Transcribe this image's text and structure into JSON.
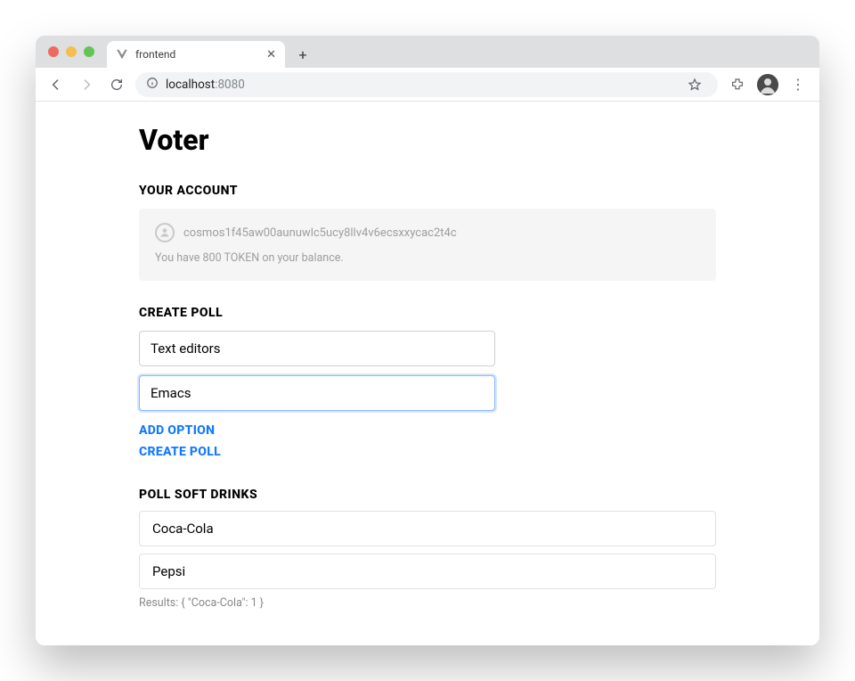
{
  "browser": {
    "tab": {
      "title": "frontend"
    },
    "address": {
      "host": "localhost",
      "port": ":8080"
    }
  },
  "header": {
    "app_title": "Voter"
  },
  "account": {
    "heading": "YOUR ACCOUNT",
    "address": "cosmos1f45aw00aunuwlc5ucy8llv4v6ecsxxycac2t4c",
    "balance_prefix": "You have ",
    "balance_amount": "800",
    "balance_token": " TOKEN",
    "balance_suffix": " on your balance."
  },
  "create_poll": {
    "heading": "CREATE POLL",
    "title_input": "Text editors",
    "option_input": "Emacs",
    "add_option_label": "ADD OPTION",
    "create_poll_label": "CREATE POLL"
  },
  "poll": {
    "heading_prefix": "POLL ",
    "heading_name": "SOFT DRINKS",
    "options": [
      "Coca-Cola",
      "Pepsi"
    ],
    "results_text": "Results: { \"Coca-Cola\": 1 }"
  }
}
